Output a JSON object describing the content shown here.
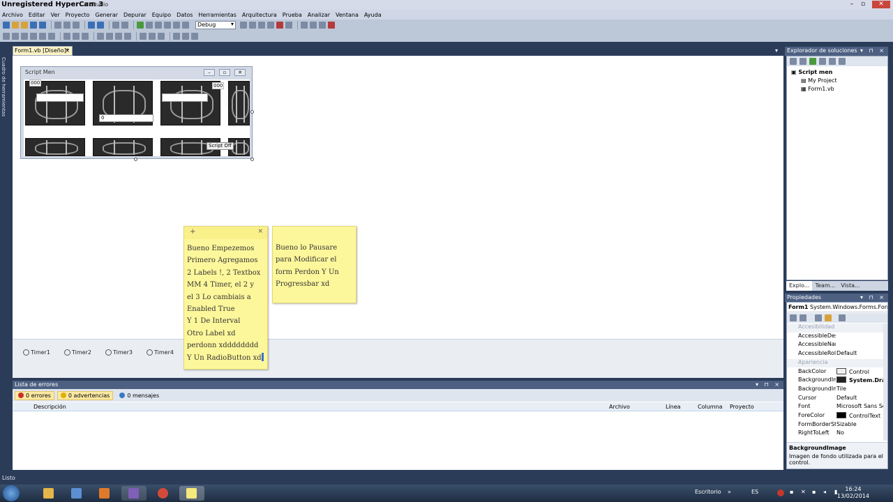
{
  "titlebar": {
    "title": "Unregistered HyperCam 3",
    "subtitle": "al Studio"
  },
  "menubar": {
    "items": [
      "Archivo",
      "Editar",
      "Ver",
      "Proyecto",
      "Generar",
      "Depurar",
      "Equipo",
      "Datos",
      "Herramientas",
      "Arquitectura",
      "Prueba",
      "Analizar",
      "Ventana",
      "Ayuda"
    ]
  },
  "toolbar": {
    "config": "Debug"
  },
  "leftstrip": {
    "label": "Cuadro de herramientas"
  },
  "doctab": {
    "label": "Form1.vb [Diseño]*",
    "close": "×"
  },
  "form": {
    "title": "Script Men",
    "label_a": "000",
    "label_b": "000",
    "numeric_value": "0",
    "button_text": "Script Off"
  },
  "tray": {
    "timers": [
      "Timer1",
      "Timer2",
      "Timer3",
      "Timer4"
    ]
  },
  "notes": {
    "note1": {
      "plus": "+",
      "close": "×",
      "text": "Bueno Empezemos\nPrimero Agregamos\n2 Labels !, 2 Textbox\nMM 4 Timer, el 2 y\nel 3 Lo cambiais a\nEnabled True\nY 1 De Interval\nOtro Label xd\nperdonn xdddddddd\nY Un RadioButton xd"
    },
    "note2": {
      "text": "Bueno lo Pausare\npara Modificar el\nform Perdon Y Un\nProgressbar xd"
    }
  },
  "solution_explorer": {
    "title": "Explorador de soluciones",
    "controls": "▾ ⊓ ×",
    "root": "Script men",
    "items": [
      "My Project",
      "Form1.vb"
    ],
    "tabs": [
      "Explo...",
      "Team...",
      "Vista..."
    ]
  },
  "properties": {
    "title": "Propiedades",
    "controls": "▾ ⊓ ×",
    "object": "Form1",
    "object_type": "System.Windows.Forms.Form",
    "rows": [
      {
        "cat": true,
        "key": "Accesibilidad"
      },
      {
        "key": "AccessibleDesc",
        "value": ""
      },
      {
        "key": "AccessibleNam",
        "value": ""
      },
      {
        "key": "AccessibleRole",
        "value": "Default"
      },
      {
        "cat": true,
        "key": "Apariencia"
      },
      {
        "key": "BackColor",
        "value": "Control",
        "swatch": "#f0f0f0"
      },
      {
        "key": "BackgroundIm",
        "value": "System.Dra",
        "swatch": "#222222",
        "bold": true
      },
      {
        "key": "BackgroundIm",
        "value": "Tile"
      },
      {
        "key": "Cursor",
        "value": "Default"
      },
      {
        "key": "Font",
        "value": "Microsoft Sans Se"
      },
      {
        "key": "ForeColor",
        "value": "ControlText",
        "swatch": "#000000"
      },
      {
        "key": "FormBorderSty",
        "value": "Sizable"
      },
      {
        "key": "RightToLeft",
        "value": "No"
      }
    ],
    "desc_title": "BackgroundImage",
    "desc_text": "Imagen de fondo utilizada para el control."
  },
  "error_list": {
    "title": "Lista de errores",
    "controls": "▾ ⊓ ×",
    "errors": "0 errores",
    "warnings": "0 advertencias",
    "messages": "0 mensajes",
    "columns": [
      "Descripción",
      "Archivo",
      "Línea",
      "Columna",
      "Proyecto"
    ]
  },
  "status": {
    "text": "Listo"
  },
  "taskbar": {
    "desktop": "Escritorio",
    "lang": "ES",
    "time": "16:24",
    "date": "13/02/2014"
  }
}
